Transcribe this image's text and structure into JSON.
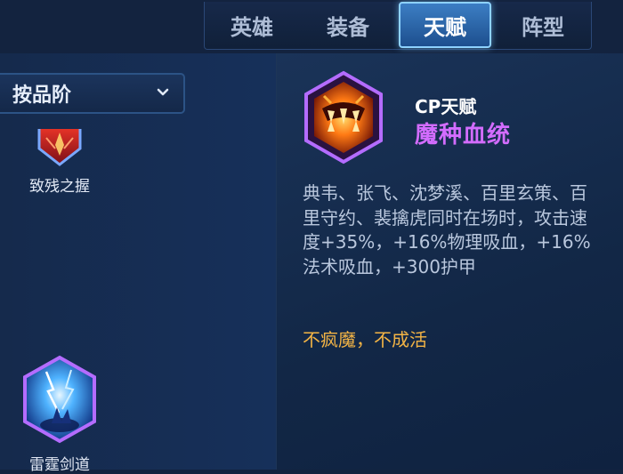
{
  "tabs": [
    {
      "label": "英雄",
      "active": false
    },
    {
      "label": "装备",
      "active": false
    },
    {
      "label": "天赋",
      "active": true
    },
    {
      "label": "阵型",
      "active": false
    }
  ],
  "filter": {
    "selected": "按品阶"
  },
  "talents": [
    {
      "name": "致残之握",
      "icon": "red-crystal-talent-icon"
    },
    {
      "name": "雷霆剑道",
      "icon": "lightning-sword-talent-icon"
    }
  ],
  "detail": {
    "category": "CP天赋",
    "name": "魔种血统",
    "icon": "demon-maw-fire-icon",
    "description": "典韦、张飞、沈梦溪、百里玄策、百里守约、裴擒虎同时在场时，攻击速度+35%，+16%物理吸血，+16%法术吸血，+300护甲",
    "flavor": "不疯魔，不成活"
  },
  "colors": {
    "accent_purple": "#d36cff",
    "flavor_gold": "#f3b445",
    "tab_active": "#3c7ec4"
  }
}
